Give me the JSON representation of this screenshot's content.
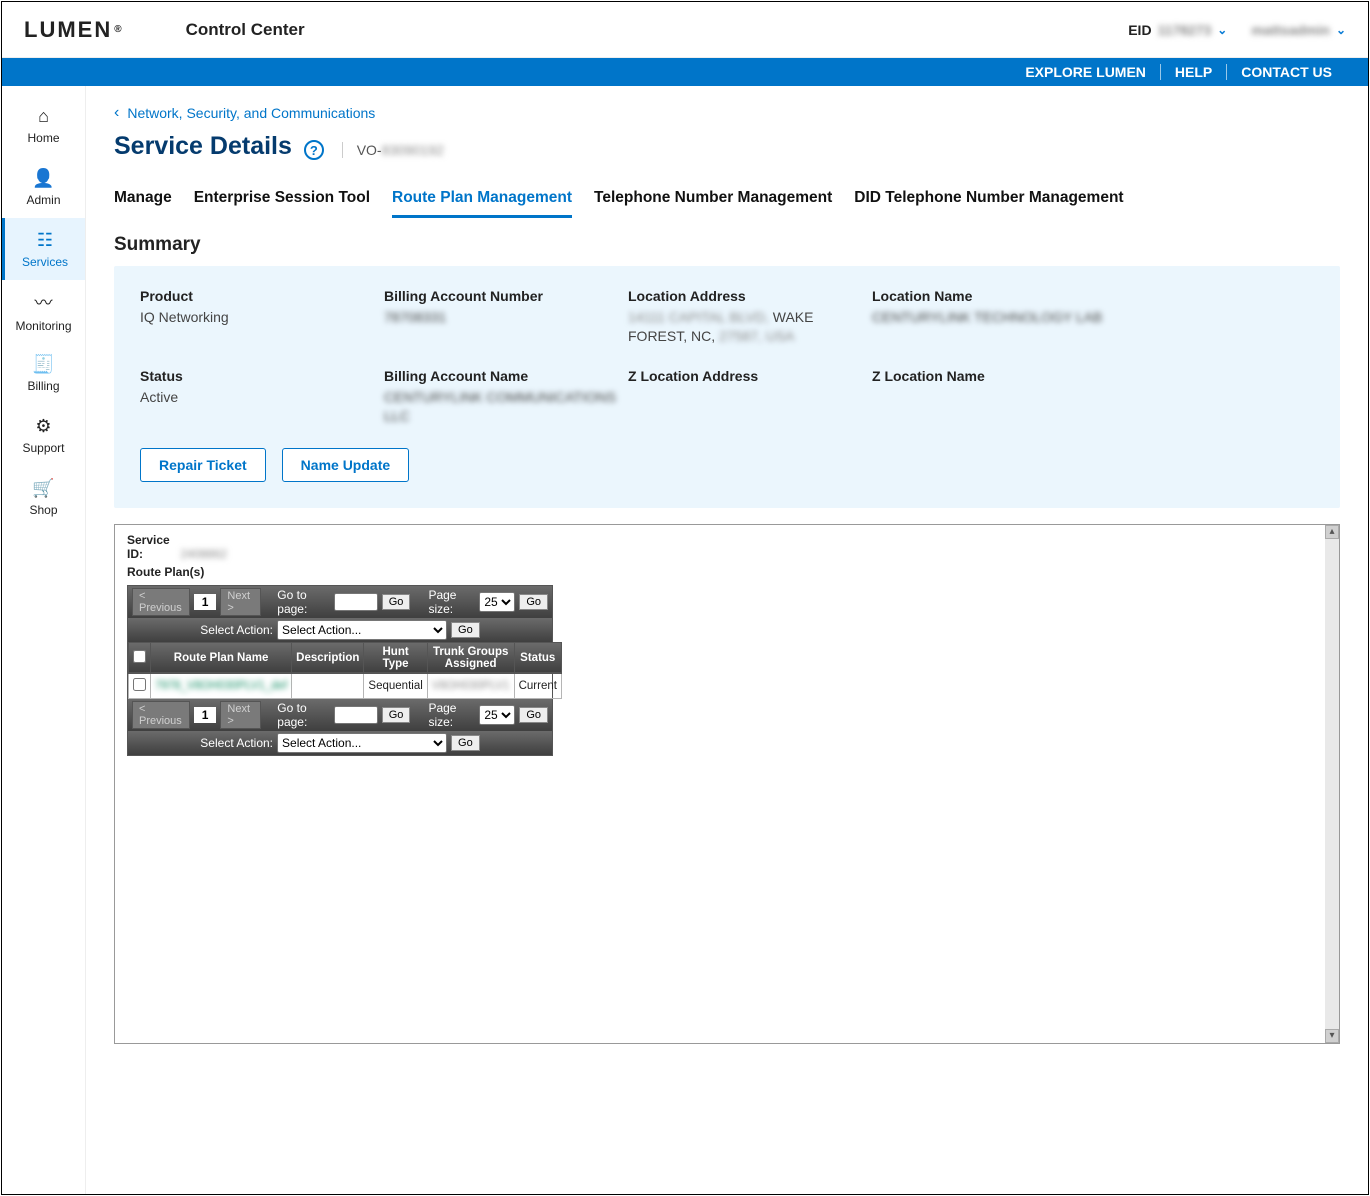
{
  "brand": {
    "name": "LUMEN",
    "app": "Control Center"
  },
  "user": {
    "eid_label": "EID",
    "eid_value": "1178273",
    "name": "mattsadmin"
  },
  "bluenav": [
    "EXPLORE LUMEN",
    "HELP",
    "CONTACT US"
  ],
  "sidebar": [
    "Home",
    "Admin",
    "Services",
    "Monitoring",
    "Billing",
    "Support",
    "Shop"
  ],
  "breadcrumb": "Network, Security, and Communications",
  "page": {
    "title": "Service Details",
    "svc_prefix": "VO-",
    "svc_code": "83090192"
  },
  "tabs": [
    "Manage",
    "Enterprise Session Tool",
    "Route Plan Management",
    "Telephone Number Management",
    "DID Telephone Number Management"
  ],
  "summary": {
    "heading": "Summary",
    "fields": {
      "product": {
        "label": "Product",
        "value": "IQ Networking"
      },
      "ban": {
        "label": "Billing Account Number",
        "value": "78708331"
      },
      "locaddr": {
        "label": "Location Address",
        "value_blur1": "14111 CAPITAL BLVD,",
        "value_clear": "WAKE FOREST, NC,",
        "value_blur2": "27587, USA"
      },
      "locname": {
        "label": "Location Name",
        "value": "CENTURYLINK TECHNOLOGY LAB"
      },
      "status": {
        "label": "Status",
        "value": "Active"
      },
      "baname": {
        "label": "Billing Account Name",
        "value": "CENTURYLINK COMMUNICATIONS LLC"
      },
      "zlocaddr": {
        "label": "Z Location Address",
        "value": ""
      },
      "zlocname": {
        "label": "Z Location Name",
        "value": ""
      }
    },
    "buttons": [
      "Repair Ticket",
      "Name Update"
    ]
  },
  "panel": {
    "service_id_label": "Service ID:",
    "service_id_value": "2408862",
    "route_plans_heading": "Route Plan(s)",
    "pager": {
      "prev": "< Previous",
      "page": "1",
      "next": "Next >",
      "goto_label": "Go to page:",
      "go": "Go",
      "pagesize_label": "Page size:",
      "pagesize_value": "25"
    },
    "action": {
      "label": "Select Action:",
      "selected": "Select Action..."
    },
    "table": {
      "headers": [
        "Route Plan Name",
        "Description",
        "Hunt Type",
        "Trunk Groups Assigned",
        "Status"
      ],
      "rows": [
        {
          "name": "7978_V8OH030PLV1_def",
          "description": "",
          "hunt_type": "Sequential",
          "trunk_groups": "V8OH030PLV1",
          "status": "Current"
        }
      ]
    }
  }
}
